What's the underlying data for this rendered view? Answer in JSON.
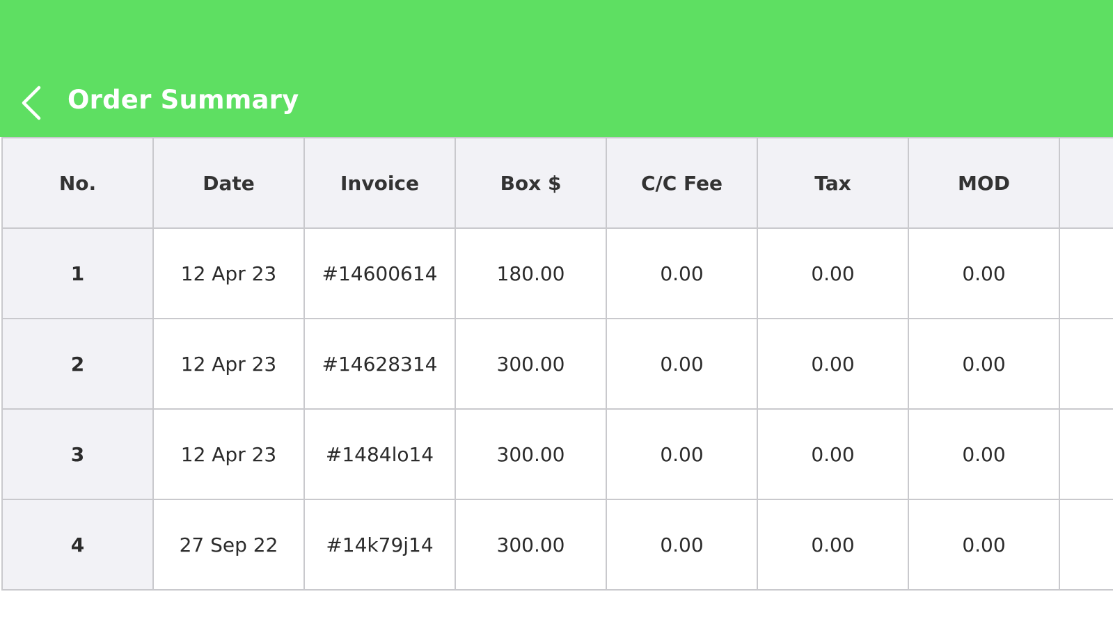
{
  "header": {
    "title": "Order Summary",
    "background": "#5edf62",
    "back_icon": "chevron-left-icon"
  },
  "table": {
    "columns": [
      "No.",
      "Date",
      "Invoice",
      "Box $",
      "C/C Fee",
      "Tax",
      "MOD",
      ""
    ],
    "rows": [
      [
        "1",
        "12 Apr 23",
        "#14600614",
        "180.00",
        "0.00",
        "0.00",
        "0.00",
        ""
      ],
      [
        "2",
        "12 Apr 23",
        "#14628314",
        "300.00",
        "0.00",
        "0.00",
        "0.00",
        ""
      ],
      [
        "3",
        "12 Apr 23",
        "#1484lo14",
        "300.00",
        "0.00",
        "0.00",
        "0.00",
        ""
      ],
      [
        "4",
        "27 Sep 22",
        "#14k79j14",
        "300.00",
        "0.00",
        "0.00",
        "0.00",
        ""
      ]
    ]
  }
}
